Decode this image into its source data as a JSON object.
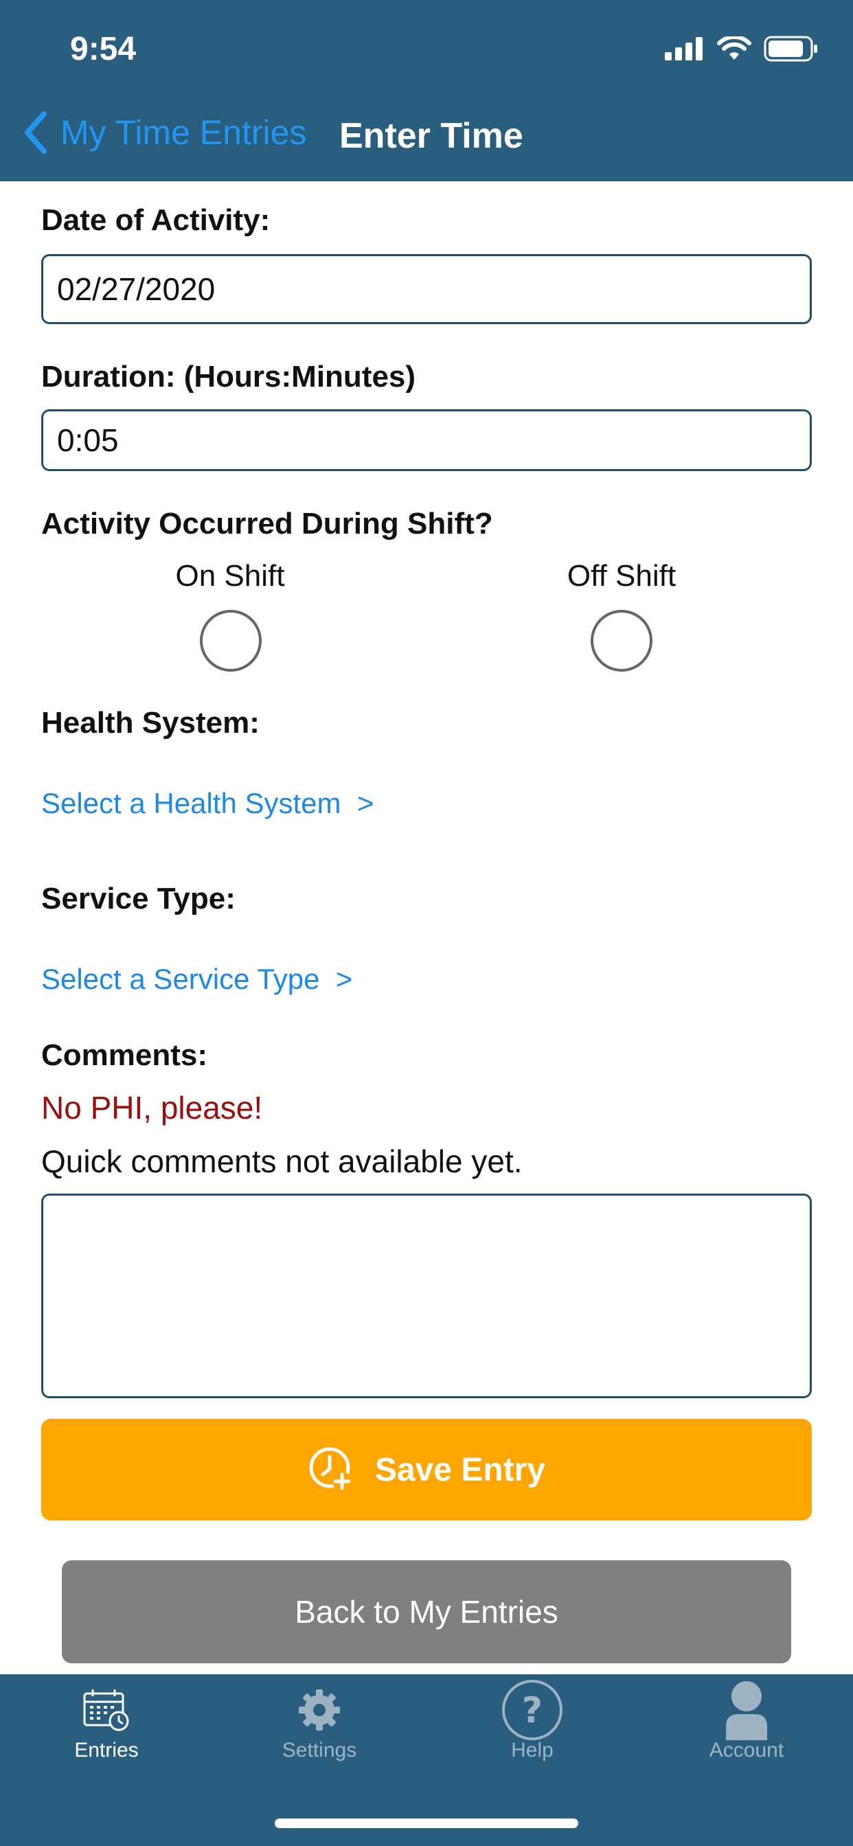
{
  "status_bar": {
    "time": "9:54"
  },
  "nav": {
    "back_label": "My Time Entries",
    "title": "Enter Time"
  },
  "form": {
    "date_label": "Date of Activity:",
    "date_value": "02/27/2020",
    "duration_label": "Duration: (Hours:Minutes)",
    "duration_value": "0:05",
    "shift_label": "Activity Occurred During Shift?",
    "on_shift": "On Shift",
    "off_shift": "Off Shift",
    "health_system_label": "Health System:",
    "health_system_link": "Select a Health System  >",
    "service_type_label": "Service Type:",
    "service_type_link": "Select a Service Type  >",
    "comments_label": "Comments:",
    "phi_warning": "No PHI, please!",
    "quick_comments": "Quick comments not available yet.",
    "comments_value": ""
  },
  "buttons": {
    "save": "Save Entry",
    "back": "Back to My Entries"
  },
  "tabs": [
    {
      "label": "Entries",
      "icon": "calendar-clock-icon",
      "active": true
    },
    {
      "label": "Settings",
      "icon": "gear-icon",
      "active": false
    },
    {
      "label": "Help",
      "icon": "question-circle-icon",
      "active": false
    },
    {
      "label": "Account",
      "icon": "person-icon",
      "active": false
    }
  ],
  "colors": {
    "header": "#2a5e7e",
    "link": "#1e88e5",
    "save_button": "#ffa500",
    "back_button": "#808080",
    "warning": "#9a0e0e",
    "tab_inactive": "#9db3c2"
  }
}
